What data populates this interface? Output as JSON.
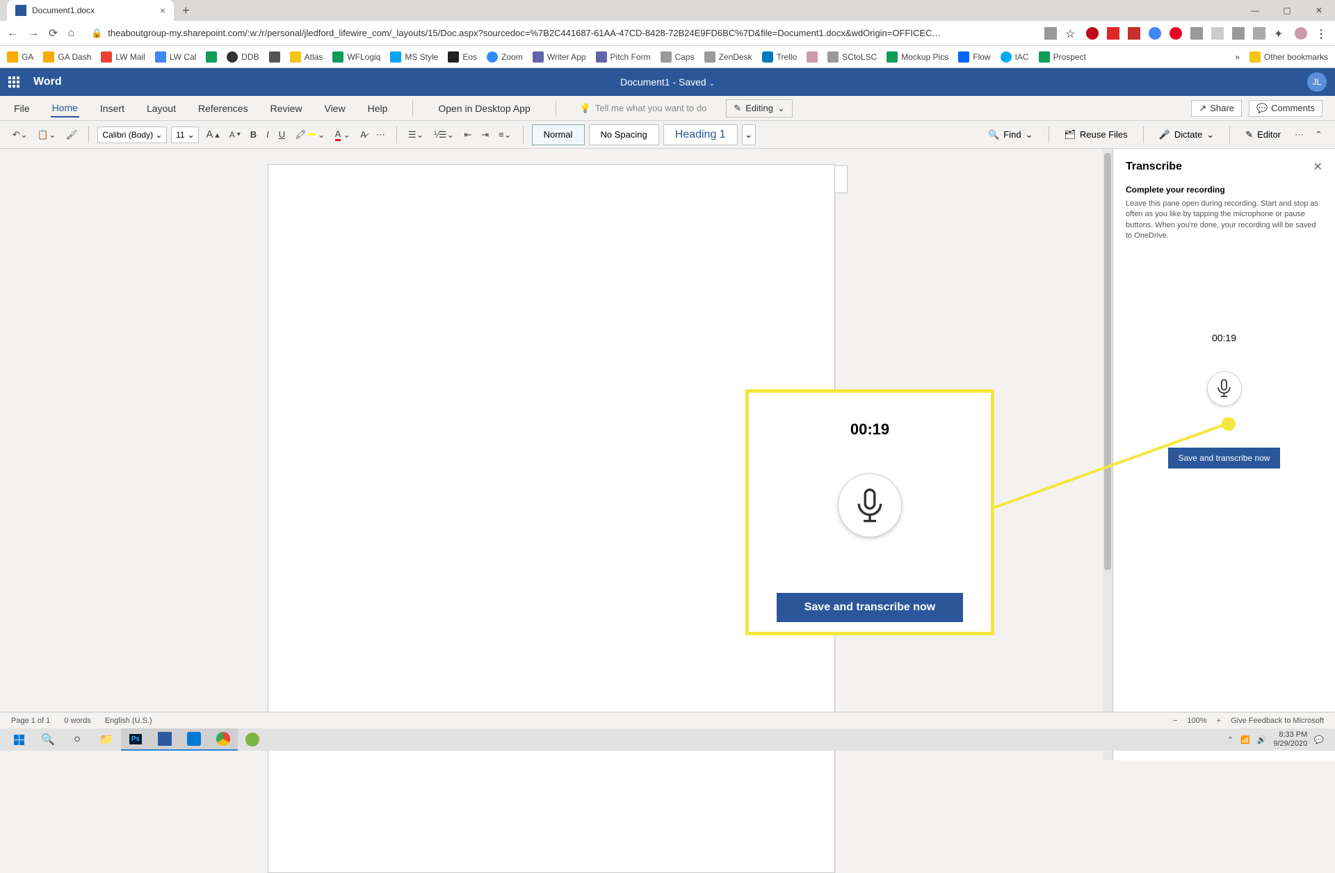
{
  "browser": {
    "tab_title": "Document1.docx",
    "url": "theaboutgroup-my.sharepoint.com/:w:/r/personal/jledford_lifewire_com/_layouts/15/Doc.aspx?sourcedoc=%7B2C441687-61AA-47CD-8428-72B24E9FD6BC%7D&file=Document1.docx&wdOrigin=OFFICEC…",
    "bookmarks": [
      "GA",
      "GA Dash",
      "LW Mail",
      "LW Cal",
      "",
      "DDB",
      "",
      "Atlas",
      "WFLogiq",
      "MS Style",
      "Eos",
      "Zoom",
      "Writer App",
      "Pitch Form",
      "Caps",
      "ZenDesk",
      "Trello",
      "",
      "SCtoLSC",
      "Mockup Pics",
      "Flow",
      "IAC",
      "Prospect"
    ],
    "other_bookmarks": "Other bookmarks"
  },
  "word": {
    "app": "Word",
    "doc_title": "Document1  -  Saved",
    "user_initials": "JL",
    "tabs": [
      "File",
      "Home",
      "Insert",
      "Layout",
      "References",
      "Review",
      "View",
      "Help"
    ],
    "open_desktop": "Open in Desktop App",
    "tell_me": "Tell me what you want to do",
    "editing": "Editing",
    "share": "Share",
    "comments": "Comments"
  },
  "toolbar": {
    "font_name": "Calibri (Body)",
    "font_size": "11",
    "styles": {
      "normal": "Normal",
      "no_spacing": "No Spacing",
      "heading1": "Heading 1"
    },
    "find": "Find",
    "reuse": "Reuse Files",
    "dictate": "Dictate",
    "editor": "Editor"
  },
  "transcribe": {
    "title": "Transcribe",
    "subtitle": "Complete your recording",
    "description": "Leave this pane open during recording. Start and stop as often as you like by tapping the microphone or pause buttons. When you're done, your recording will be saved to OneDrive.",
    "timer": "00:19",
    "save": "Save and transcribe now"
  },
  "callout": {
    "timer": "00:19",
    "save": "Save and transcribe now"
  },
  "status": {
    "page": "Page 1 of 1",
    "words": "0 words",
    "lang": "English (U.S.)",
    "zoom": "100%",
    "feedback": "Give Feedback to Microsoft"
  },
  "tray": {
    "time": "8:33 PM",
    "date": "9/29/2020"
  }
}
